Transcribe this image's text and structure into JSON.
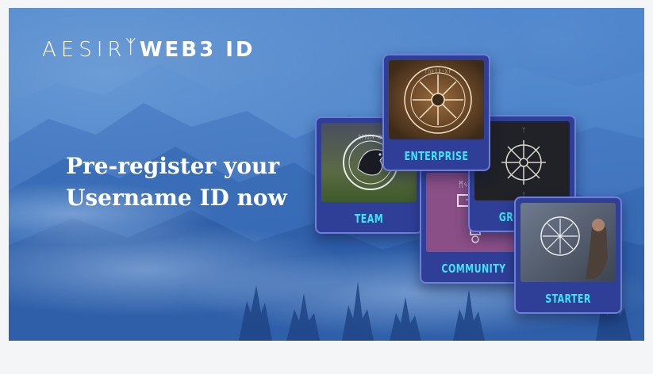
{
  "brand": {
    "name_left": "AESIR",
    "rune": "ᛉ",
    "name_right": "WEB3 ID"
  },
  "headline": {
    "line1": "Pre-register your",
    "line2": "Username ID now"
  },
  "cards": {
    "team": {
      "label": "TEAM",
      "art": "raven-emblem"
    },
    "enterprise": {
      "label": "ENTERPRISE",
      "art": "runic-compass"
    },
    "community": {
      "label": "COMMUNITY",
      "art": "thor-hammer"
    },
    "growth": {
      "label": "GROWTH",
      "art": "vegvisir"
    },
    "starter": {
      "label": "STARTER",
      "art": "viking-figure"
    }
  },
  "colors": {
    "sky": "#3a72bf",
    "card_bg": "#2f3f98",
    "card_border": "#6f7ed8",
    "label": "#3fe3f1",
    "page_bg": "#f4f5f7"
  }
}
